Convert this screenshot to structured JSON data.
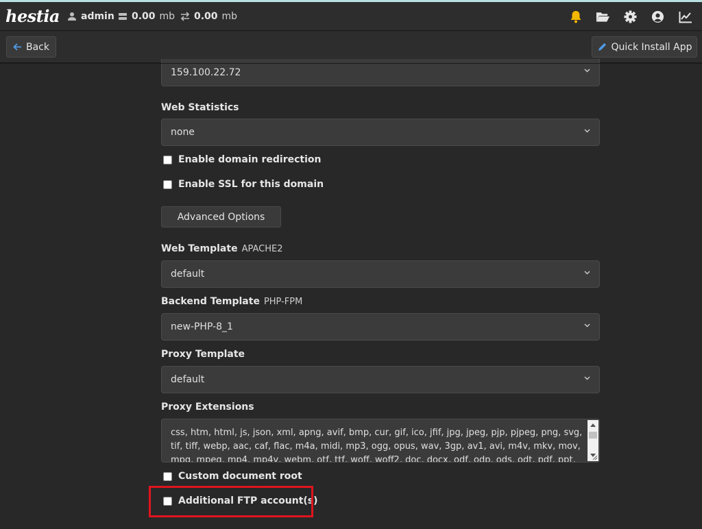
{
  "header": {
    "logo_text": "hestia",
    "user": "admin",
    "disk_value": "0.00",
    "disk_unit": "mb",
    "bandwidth_value": "0.00",
    "bandwidth_unit": "mb",
    "icons": [
      "bell-icon",
      "folder-open-icon",
      "gear-icon",
      "user-circle-icon",
      "chart-line-icon"
    ],
    "bell_color": "#f5b800"
  },
  "toolbar": {
    "back_label": "Back",
    "quick_install_label": "Quick Install App"
  },
  "form": {
    "ip_value": "159.100.22.72",
    "web_statistics_label": "Web Statistics",
    "web_statistics_value": "none",
    "enable_redirection_label": "Enable domain redirection",
    "enable_ssl_label": "Enable SSL for this domain",
    "advanced_options_label": "Advanced Options",
    "web_template_label": "Web Template",
    "web_template_sub": "APACHE2",
    "web_template_value": "default",
    "backend_template_label": "Backend Template",
    "backend_template_sub": "PHP-FPM",
    "backend_template_value": "new-PHP-8_1",
    "proxy_template_label": "Proxy Template",
    "proxy_template_value": "default",
    "proxy_extensions_label": "Proxy Extensions",
    "proxy_extensions_value": "css, htm, html, js, json, xml, apng, avif, bmp, cur, gif, ico, jfif, jpg, jpeg, pjp, pjpeg, png, svg, tif, tiff, webp, aac, caf, flac, m4a, midi, mp3, ogg, opus, wav, 3gp, av1, avi, m4v, mkv, mov, mpg, mpeg, mp4, mp4v, webm, otf, ttf, woff, woff2, doc, docx, odf, odp, ods, odt, pdf, ppt, pptx, rtf, txt, xls",
    "custom_docroot_label": "Custom document root",
    "additional_ftp_label": "Additional FTP account(s)"
  },
  "colors": {
    "highlight": "#e0141e",
    "accent": "#4f9be8"
  }
}
